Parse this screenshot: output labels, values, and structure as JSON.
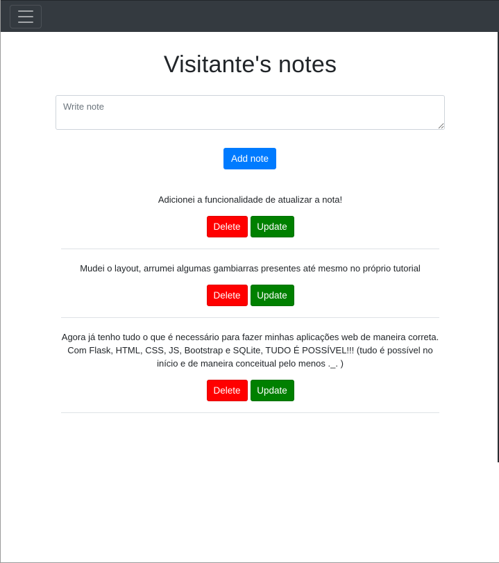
{
  "navbar": {
    "toggler_icon": "hamburger-menu-icon"
  },
  "page": {
    "title": "Visitante's notes"
  },
  "form": {
    "note_placeholder": "Write note",
    "note_value": "",
    "add_label": "Add note"
  },
  "notes": [
    {
      "text": "Adicionei a funcionalidade de atualizar a nota!",
      "delete_label": "Delete",
      "update_label": "Update"
    },
    {
      "text": "Mudei o layout, arrumei algumas gambiarras presentes até mesmo no próprio tutorial",
      "delete_label": "Delete",
      "update_label": "Update"
    },
    {
      "text": "Agora já tenho tudo o que é necessário para fazer minhas aplicações web de maneira correta. Com Flask, HTML, CSS, JS, Bootstrap e SQLite, TUDO É POSSÍVEL!!! (tudo é possível no início e de maneira conceitual pelo menos ._. )",
      "delete_label": "Delete",
      "update_label": "Update"
    }
  ],
  "colors": {
    "navbar": "#343a40",
    "primary": "#007bff",
    "delete": "#ff0000",
    "update": "#008000"
  }
}
